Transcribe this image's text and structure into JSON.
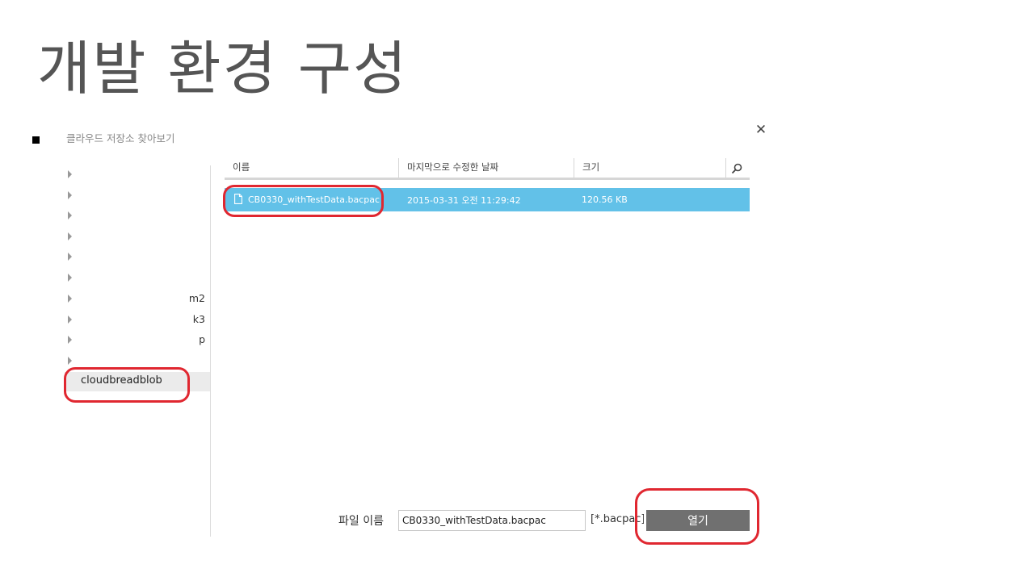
{
  "slide": {
    "title": "개발 환경 구성"
  },
  "dialog": {
    "title": "클라우드 저장소 찾아보기",
    "close_icon": "close-icon"
  },
  "sidebar": {
    "items": [
      {
        "label": ""
      },
      {
        "label": ""
      },
      {
        "label": ""
      },
      {
        "label": ""
      },
      {
        "label": ""
      },
      {
        "label": ""
      },
      {
        "label": "m2"
      },
      {
        "label": "k3"
      },
      {
        "label": "p"
      },
      {
        "label": ""
      }
    ],
    "selected_label": "cloudbreadblob"
  },
  "file_list": {
    "columns": [
      "이름",
      "마지막으로 수정한 날짜",
      "크기"
    ],
    "search_icon": "search-icon",
    "rows": [
      {
        "name": "CB0330_withTestData.bacpac",
        "modified": "2015-03-31 오전 11:29:42",
        "size": "120.56 KB",
        "icon": "file-icon"
      }
    ]
  },
  "footer": {
    "filename_label": "파일 이름",
    "filename_value": "CB0330_withTestData.bacpac",
    "filter_text": "[*.bacpac]",
    "open_button": "열기"
  },
  "colors": {
    "selection": "#62c1e8",
    "button": "#707070",
    "annotation": "#e02730"
  }
}
